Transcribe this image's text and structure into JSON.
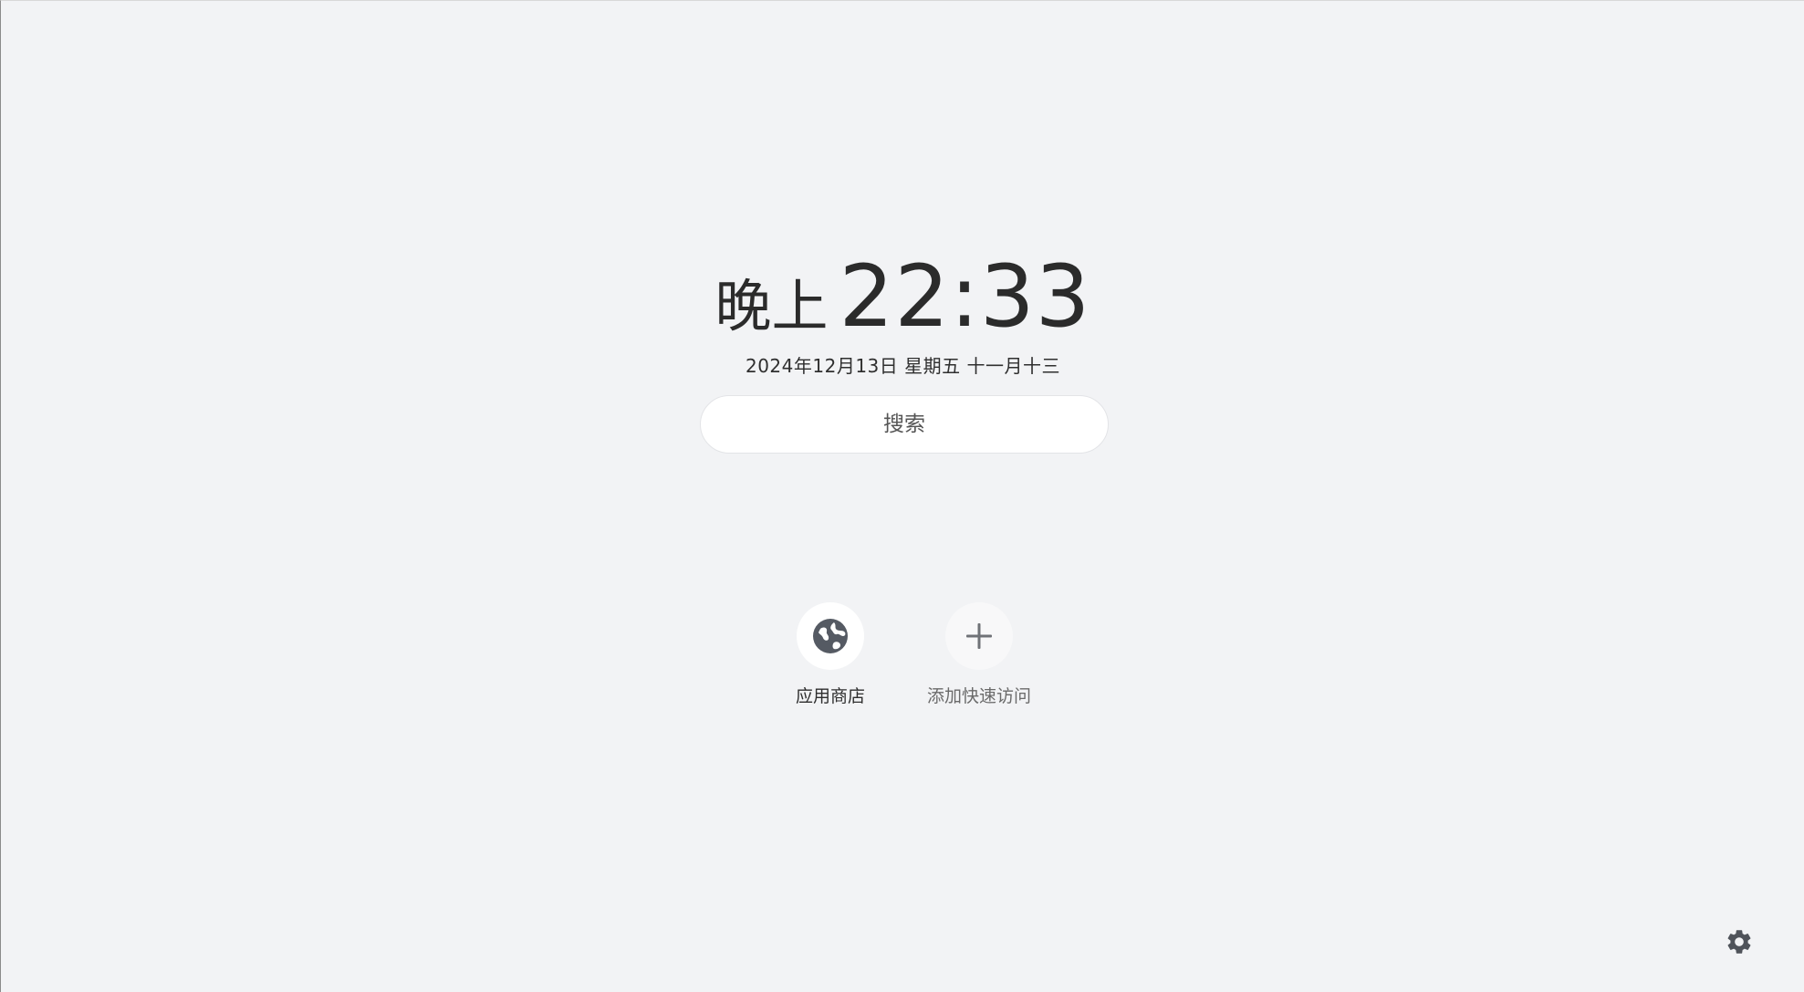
{
  "clock": {
    "period": "晚上",
    "time": "22:33"
  },
  "date": {
    "text": "2024年12月13日 星期五 十一月十三"
  },
  "search": {
    "placeholder": "搜索"
  },
  "shortcuts": [
    {
      "label": "应用商店",
      "icon": "globe-icon"
    },
    {
      "label": "添加快速访问",
      "icon": "plus-icon"
    }
  ],
  "settings": {
    "icon": "gear-icon"
  },
  "colors": {
    "background": "#f2f3f5",
    "text": "#2b2b2b",
    "icon": "#555a63",
    "muted": "#6a6a6a"
  }
}
